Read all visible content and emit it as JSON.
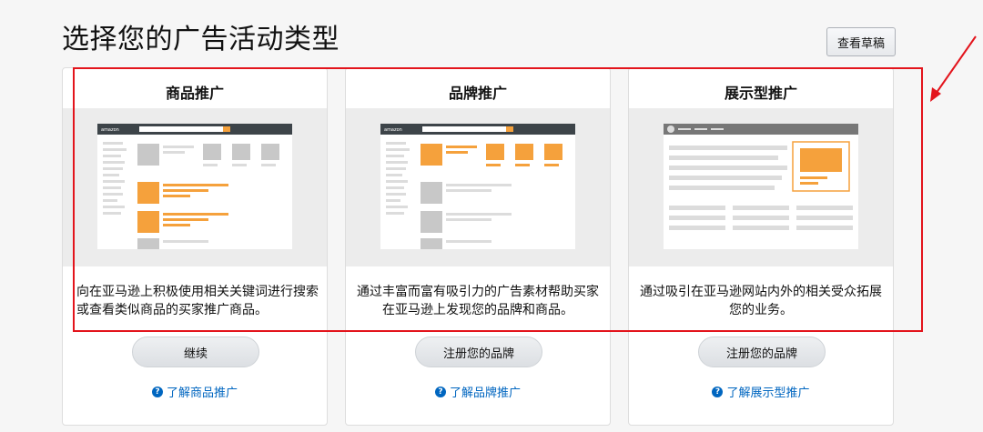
{
  "page": {
    "title": "选择您的广告活动类型",
    "draft_button": "查看草稿"
  },
  "cards": [
    {
      "title": "商品推广",
      "description": "向在亚马逊上积极使用相关关键词进行搜索或查看类似商品的买家推广商品。",
      "button": "继续",
      "learn_more": "了解商品推广"
    },
    {
      "title": "品牌推广",
      "description": "通过丰富而富有吸引力的广告素材帮助买家在亚马逊上发现您的品牌和商品。",
      "button": "注册您的品牌",
      "learn_more": "了解品牌推广"
    },
    {
      "title": "展示型推广",
      "description": "通过吸引在亚马逊网站内外的相关受众拓展您的业务。",
      "button": "注册您的品牌",
      "learn_more": "了解展示型推广"
    }
  ],
  "illustration": {
    "logo_text": "amazon"
  },
  "colors": {
    "accent_orange": "#f5a13c",
    "annotation_red": "#e3141c",
    "link_blue": "#0066c0",
    "header_dark": "#3d4449"
  },
  "icons": [
    "help-icon",
    "image-placeholder-icon",
    "annotation-arrow-icon"
  ]
}
